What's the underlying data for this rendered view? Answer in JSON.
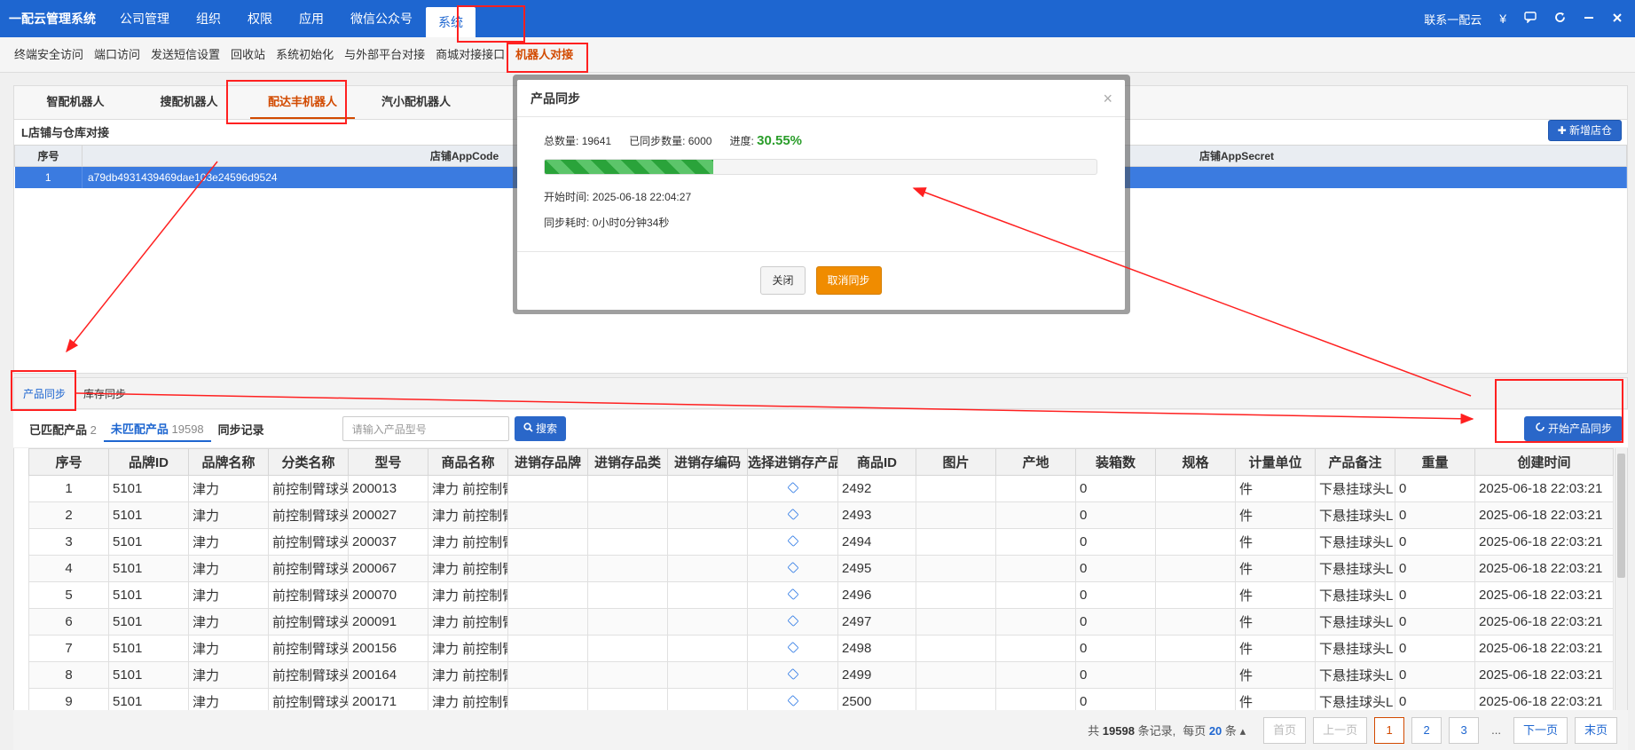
{
  "app": {
    "brand": "一配云管理系统",
    "top_nav": [
      "公司管理",
      "组织",
      "权限",
      "应用",
      "微信公众号",
      "系统"
    ],
    "top_nav_active": 5,
    "contact": "联系一配云",
    "yen_icon": "¥"
  },
  "sub_nav": {
    "items": [
      "终端安全访问",
      "端口访问",
      "发送短信设置",
      "回收站",
      "系统初始化",
      "与外部平台对接",
      "商城对接接口",
      "机器人对接"
    ],
    "active": 7
  },
  "robot_tabs": {
    "items": [
      "智配机器人",
      "搜配机器人",
      "配达丰机器人",
      "汽小配机器人"
    ],
    "active": 2
  },
  "store_section": {
    "title": "L店铺与仓库对接",
    "add_button": "新增店仓",
    "columns": [
      "序号",
      "店铺AppCode",
      "店铺AppSecret"
    ],
    "rows": [
      {
        "index": "1",
        "app_code": "a79db4931439469dae103e24596d9524"
      }
    ]
  },
  "sync_tabs": {
    "items": [
      "产品同步",
      "库存同步"
    ],
    "active": 0
  },
  "filter": {
    "matched_label": "已匹配产品",
    "matched_count": "2",
    "unmatched_label": "未匹配产品",
    "unmatched_count": "19598",
    "record_label": "同步记录",
    "search_placeholder": "请输入产品型号",
    "search_button": "搜索",
    "start_sync_button": "开始产品同步"
  },
  "product_table": {
    "columns": [
      "序号",
      "品牌ID",
      "品牌名称",
      "分类名称",
      "型号",
      "商品名称",
      "进销存品牌",
      "进销存品类",
      "进销存编码",
      "选择进销存产品",
      "商品ID",
      "图片",
      "产地",
      "装箱数",
      "规格",
      "计量单位",
      "产品备注",
      "重量",
      "创建时间"
    ],
    "rows": [
      [
        "1",
        "5101",
        "津力",
        "前控制臂球头",
        "200013",
        "津力 前控制臂",
        "",
        "",
        "",
        "cube",
        "2492",
        "",
        "",
        "0",
        "",
        "件",
        "下悬挂球头L",
        "0",
        "2025-06-18 22:03:21"
      ],
      [
        "2",
        "5101",
        "津力",
        "前控制臂球头",
        "200027",
        "津力 前控制臂",
        "",
        "",
        "",
        "cube",
        "2493",
        "",
        "",
        "0",
        "",
        "件",
        "下悬挂球头L",
        "0",
        "2025-06-18 22:03:21"
      ],
      [
        "3",
        "5101",
        "津力",
        "前控制臂球头",
        "200037",
        "津力 前控制臂",
        "",
        "",
        "",
        "cube",
        "2494",
        "",
        "",
        "0",
        "",
        "件",
        "下悬挂球头L",
        "0",
        "2025-06-18 22:03:21"
      ],
      [
        "4",
        "5101",
        "津力",
        "前控制臂球头",
        "200067",
        "津力 前控制臂",
        "",
        "",
        "",
        "cube",
        "2495",
        "",
        "",
        "0",
        "",
        "件",
        "下悬挂球头L",
        "0",
        "2025-06-18 22:03:21"
      ],
      [
        "5",
        "5101",
        "津力",
        "前控制臂球头",
        "200070",
        "津力 前控制臂",
        "",
        "",
        "",
        "cube",
        "2496",
        "",
        "",
        "0",
        "",
        "件",
        "下悬挂球头L",
        "0",
        "2025-06-18 22:03:21"
      ],
      [
        "6",
        "5101",
        "津力",
        "前控制臂球头",
        "200091",
        "津力 前控制臂",
        "",
        "",
        "",
        "cube",
        "2497",
        "",
        "",
        "0",
        "",
        "件",
        "下悬挂球头L",
        "0",
        "2025-06-18 22:03:21"
      ],
      [
        "7",
        "5101",
        "津力",
        "前控制臂球头",
        "200156",
        "津力 前控制臂",
        "",
        "",
        "",
        "cube",
        "2498",
        "",
        "",
        "0",
        "",
        "件",
        "下悬挂球头L",
        "0",
        "2025-06-18 22:03:21"
      ],
      [
        "8",
        "5101",
        "津力",
        "前控制臂球头",
        "200164",
        "津力 前控制臂",
        "",
        "",
        "",
        "cube",
        "2499",
        "",
        "",
        "0",
        "",
        "件",
        "下悬挂球头L",
        "0",
        "2025-06-18 22:03:21"
      ],
      [
        "9",
        "5101",
        "津力",
        "前控制臂球头",
        "200171",
        "津力 前控制臂",
        "",
        "",
        "",
        "cube",
        "2500",
        "",
        "",
        "0",
        "",
        "件",
        "下悬挂球头L",
        "0",
        "2025-06-18 22:03:21"
      ]
    ]
  },
  "pager": {
    "total_prefix": "共",
    "total": "19598",
    "total_suffix": "条记录,",
    "per_prefix": "每页",
    "per_page": "20",
    "per_suffix": "条",
    "first": "首页",
    "prev": "上一页",
    "pages": [
      "1",
      "2",
      "3"
    ],
    "current": "1",
    "dots": "...",
    "next": "下一页",
    "last": "末页"
  },
  "modal": {
    "title": "产品同步",
    "close_symbol": "×",
    "total_label": "总数量:",
    "total": "19641",
    "synced_label": "已同步数量:",
    "synced": "6000",
    "progress_label": "进度:",
    "progress_text": "30.55%",
    "progress": 0.3055,
    "start_time_label": "开始时间:",
    "start_time": "2025-06-18 22:04:27",
    "elapsed_label": "同步耗时:",
    "elapsed": "0小时0分钟34秒",
    "close_button": "关闭",
    "cancel_button": "取消同步"
  },
  "colors": {
    "primary": "#1e66d0",
    "accent_orange": "#d24a00",
    "progress_green": "#2aa33a",
    "annotation_red": "#ff2020"
  }
}
